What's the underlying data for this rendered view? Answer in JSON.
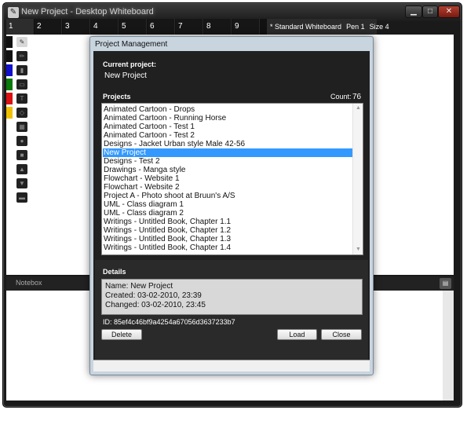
{
  "window": {
    "title": "New Project - Desktop Whiteboard",
    "min_glyph": "▁",
    "max_glyph": "□",
    "close_glyph": "✕"
  },
  "tabs": [
    "1",
    "2",
    "3",
    "4",
    "5",
    "6",
    "7",
    "8",
    "9"
  ],
  "status": {
    "board": "* Standard Whiteboard",
    "pen": "Pen 1",
    "size": "Size 4"
  },
  "toolbar": {
    "colors": [
      "#111111",
      "#111111",
      "#1010cc",
      "#0a7a0a",
      "#dd1111",
      "#f0c000"
    ],
    "tools": [
      "pen-icon",
      "pencil-icon",
      "highlighter-icon",
      "eraser-icon",
      "text-icon",
      "shape-icon",
      "grid-icon",
      "circle-icon",
      "rectangle-icon",
      "triangle-up-icon",
      "triangle-down-icon",
      "image-icon"
    ]
  },
  "notebox": {
    "label": "Notebox"
  },
  "dialog": {
    "title": "Project Management",
    "current_project_label": "Current project:",
    "current_project": "New Project",
    "projects_label": "Projects",
    "count_label": "Count:",
    "count": "76",
    "projects": [
      "Animated Cartoon - Drops",
      "Animated Cartoon - Running Horse",
      "Animated Cartoon - Test 1",
      "Animated Cartoon - Test 2",
      "Designs - Jacket Urban style Male 42-56",
      "New Project",
      "Designs - Test 2",
      "Drawings - Manga style",
      "Flowchart - Website 1",
      "Flowchart - Website 2",
      "Project A - Photo shoot at Bruun's A/S",
      "UML - Class diagram 1",
      "UML - Class diagram 2",
      "Writings - Untitled Book, Chapter 1.1",
      "Writings - Untitled Book, Chapter 1.2",
      "Writings - Untitled Book, Chapter 1.3",
      "Writings - Untitled Book, Chapter 1.4"
    ],
    "selected_index": 5,
    "details_label": "Details",
    "details": {
      "name": "Name: New Project",
      "created": "Created: 03-02-2010, 23:39",
      "changed": "Changed: 03-02-2010, 23:45"
    },
    "id": "ID: 85ef4c46bf9a4254a67056d3637233b7",
    "buttons": {
      "delete": "Delete",
      "load": "Load",
      "close": "Close"
    }
  }
}
